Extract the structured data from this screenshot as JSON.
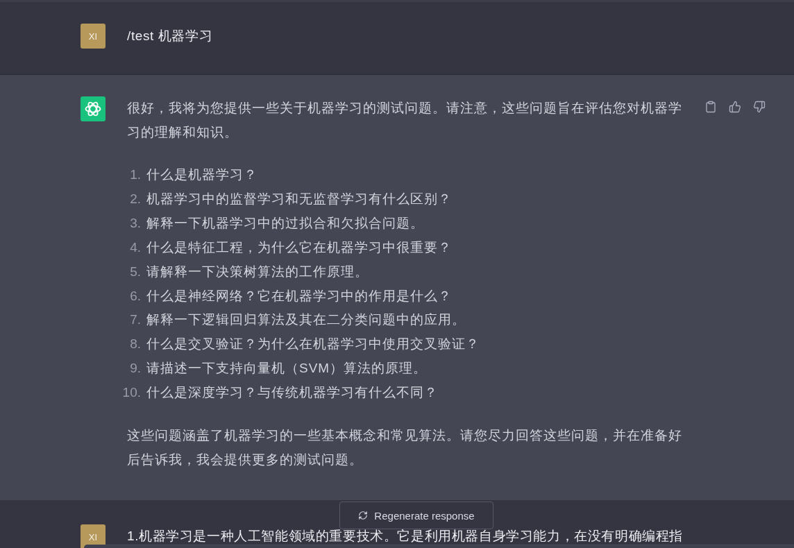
{
  "messages": [
    {
      "kind": "user",
      "avatar": "XI",
      "text": "/test 机器学习"
    },
    {
      "kind": "assistant",
      "intro": "很好，我将为您提供一些关于机器学习的测试问题。请注意，这些问题旨在评估您对机器学习的理解和知识。",
      "list": [
        {
          "number": "1.",
          "text": "什么是机器学习？"
        },
        {
          "number": "2.",
          "text": "机器学习中的监督学习和无监督学习有什么区别？"
        },
        {
          "number": "3.",
          "text": "解释一下机器学习中的过拟合和欠拟合问题。"
        },
        {
          "number": "4.",
          "text": "什么是特征工程，为什么它在机器学习中很重要？"
        },
        {
          "number": "5.",
          "text": "请解释一下决策树算法的工作原理。"
        },
        {
          "number": "6.",
          "text": "什么是神经网络？它在机器学习中的作用是什么？"
        },
        {
          "number": "7.",
          "text": "解释一下逻辑回归算法及其在二分类问题中的应用。"
        },
        {
          "number": "8.",
          "text": "什么是交叉验证？为什么在机器学习中使用交叉验证？"
        },
        {
          "number": "9.",
          "text": "请描述一下支持向量机（SVM）算法的原理。"
        },
        {
          "number": "10.",
          "text": "什么是深度学习？与传统机器学习有什么不同？"
        }
      ],
      "closing": "这些问题涵盖了机器学习的一些基本概念和常见算法。请您尽力回答这些问题，并在准备好后告诉我，我会提供更多的测试问题。"
    },
    {
      "kind": "user",
      "avatar": "XI",
      "text": "1.机器学习是一种人工智能领域的重要技术。它是利用机器自身学习能力，在没有明确编程指"
    }
  ],
  "regenerate_button": {
    "label": "Regenerate response"
  }
}
